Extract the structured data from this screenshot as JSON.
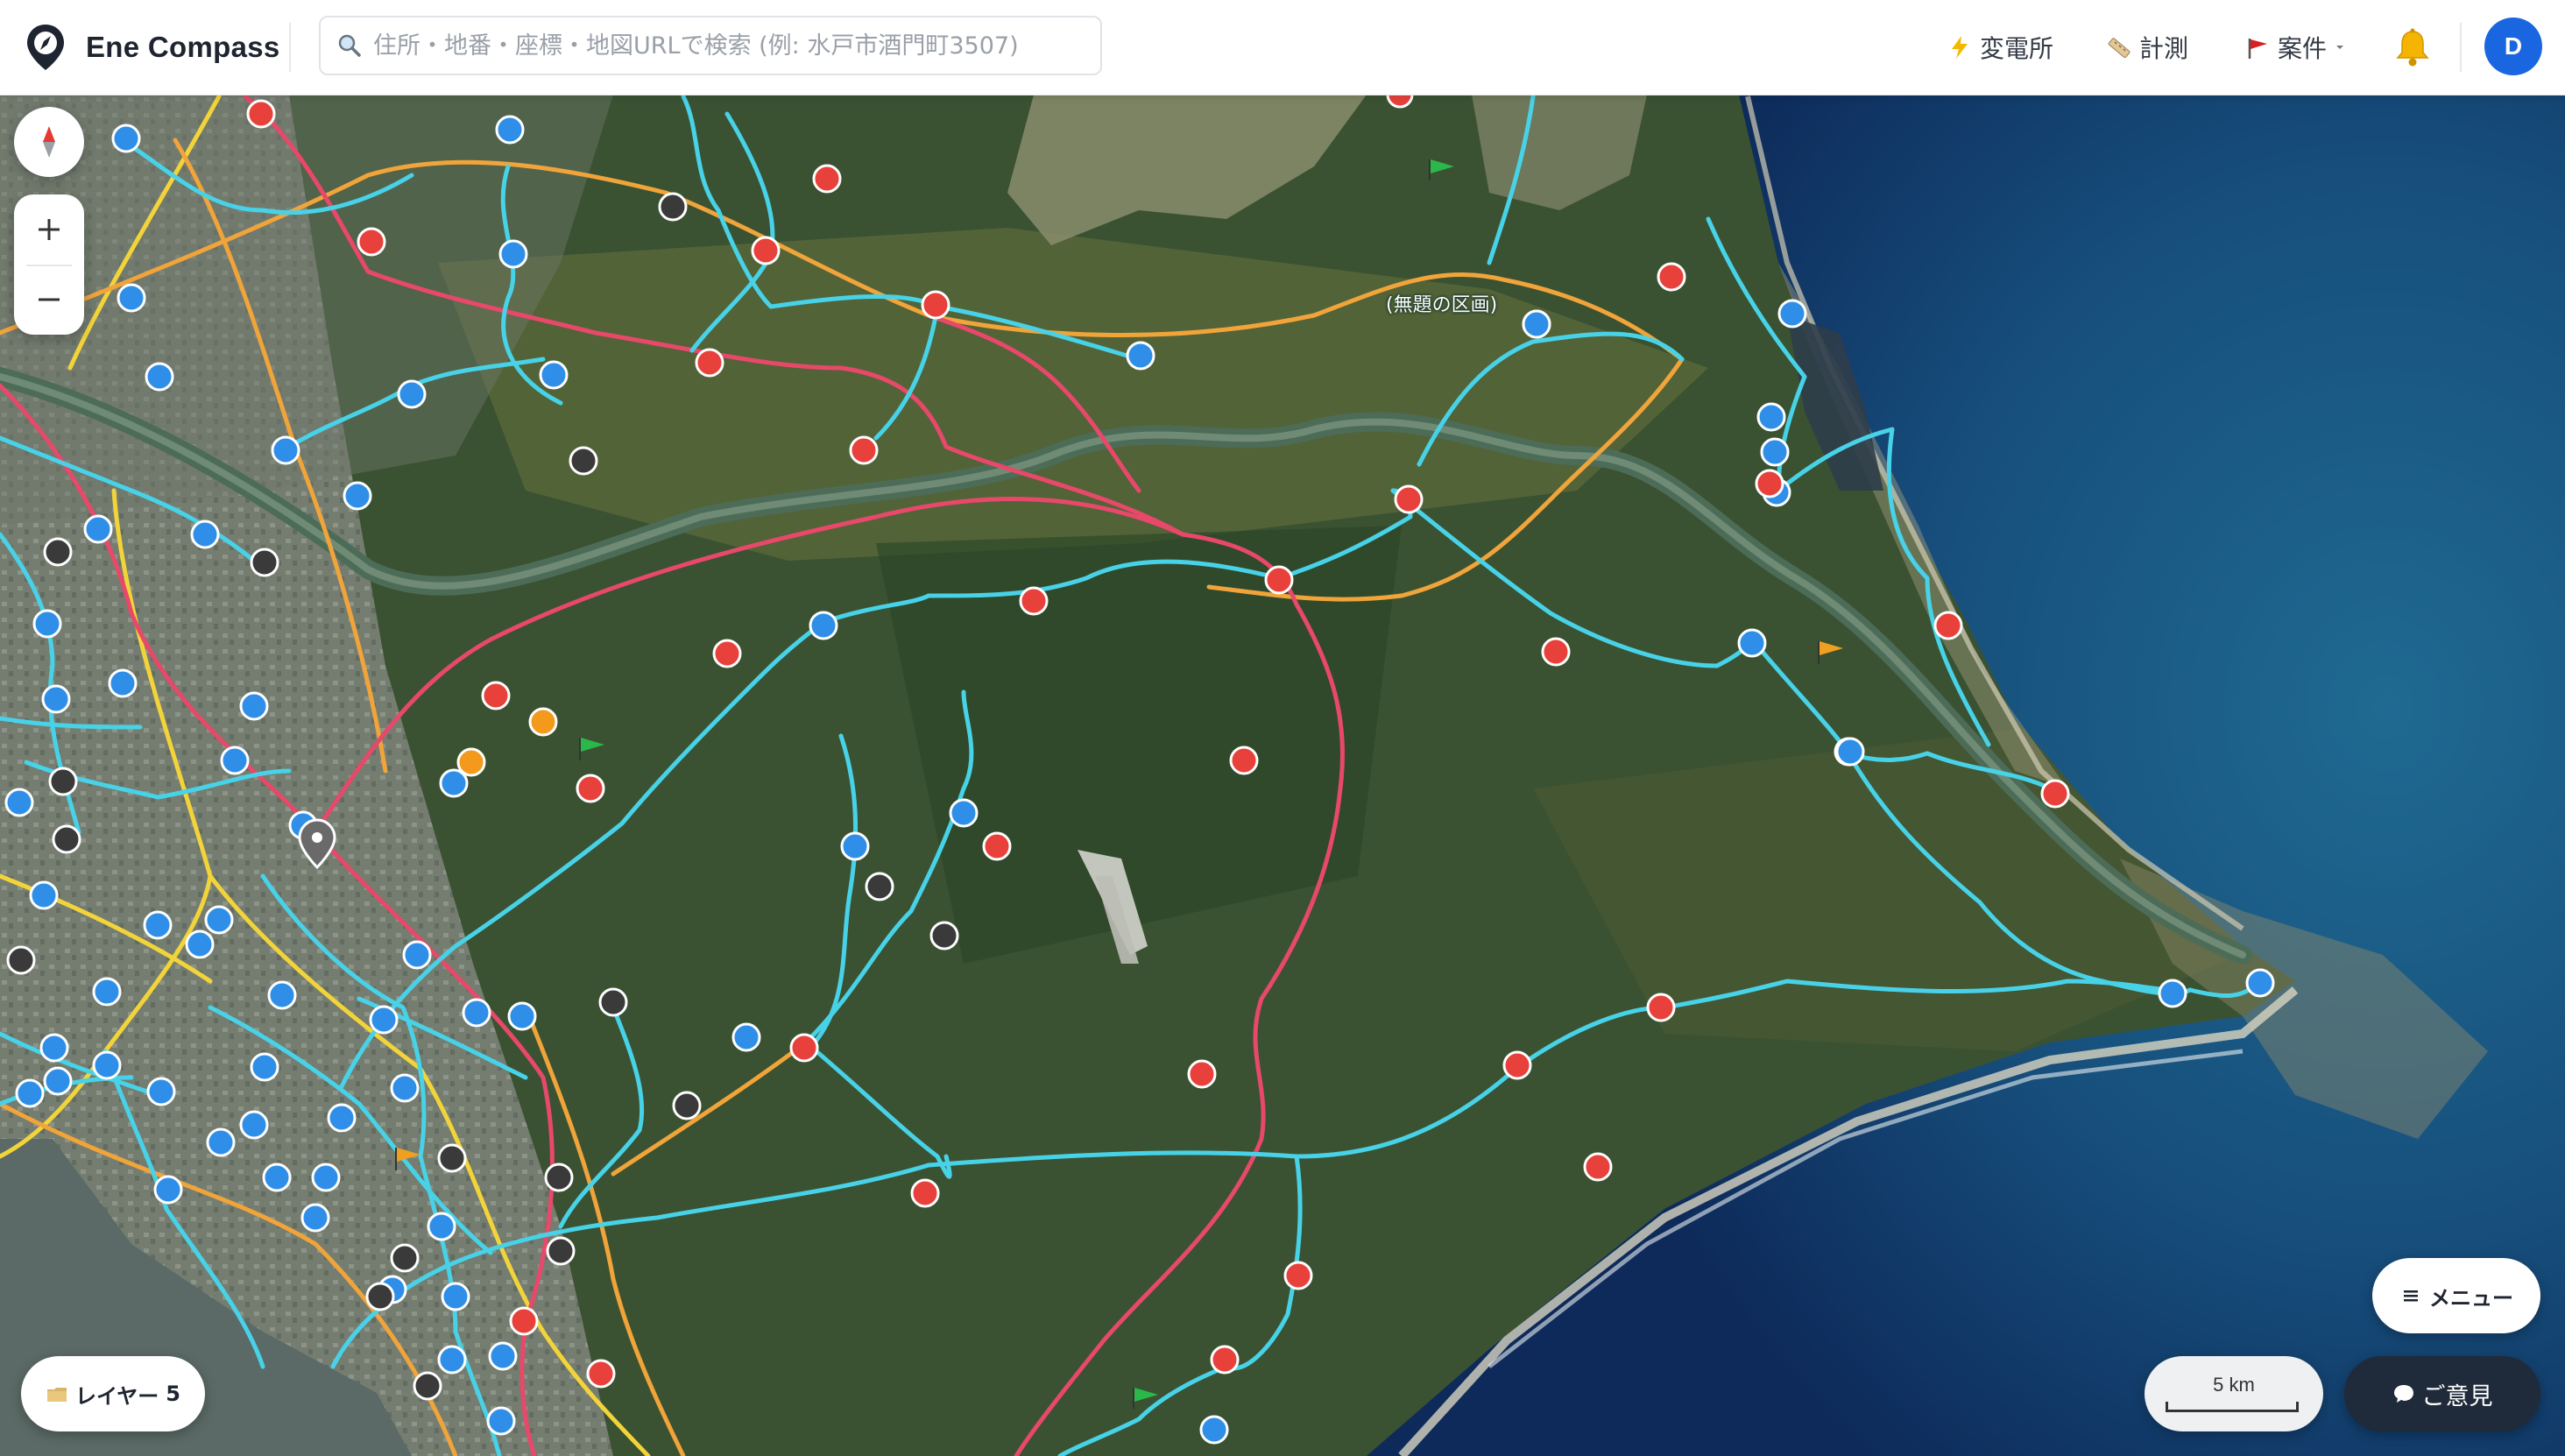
{
  "app": {
    "title": "Ene Compass"
  },
  "search": {
    "placeholder": "住所・地番・座標・地図URLで検索 (例: 水戸市酒門町3507)"
  },
  "header": {
    "substation_label": "変電所",
    "measure_label": "計測",
    "projects_label": "案件",
    "avatar_initial": "D"
  },
  "map": {
    "annotation_label": "(無題の区画)",
    "scale_label": "5 km"
  },
  "controls": {
    "layers_label": "レイヤー",
    "layers_count": "5",
    "menu_label": "メニュー",
    "feedback_label": "ご意見"
  },
  "colors": {
    "primary": "#1a66e0",
    "marker_blue": "#2f8fe8",
    "marker_red": "#e8403a",
    "marker_dark": "#3a3a3a",
    "marker_orange": "#f39a1c",
    "line_cyan": "#48d2e8",
    "line_red": "#e8486a",
    "line_orange": "#f0a43a",
    "line_yellow": "#f2d43a",
    "feedback_bg": "#1f2a3a"
  },
  "icons": [
    "compass-logo-icon",
    "search-icon",
    "lightning-icon",
    "ruler-icon",
    "red-flag-icon",
    "chevron-down-icon",
    "bell-icon",
    "north-arrow-icon",
    "zoom-in-icon",
    "zoom-out-icon",
    "layers-icon",
    "menu-icon",
    "chat-icon",
    "map-pin-icon",
    "flag-icon"
  ]
}
